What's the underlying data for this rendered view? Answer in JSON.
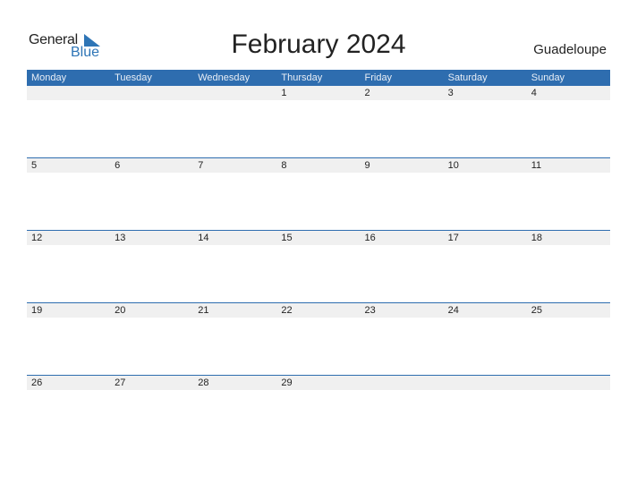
{
  "logo": {
    "text_general": "General",
    "text_blue": "Blue"
  },
  "title": "February 2024",
  "country": "Guadeloupe",
  "colors": {
    "header_bg": "#2e6daf",
    "strip_bg": "#f0f0f0",
    "accent": "#2e75b6"
  },
  "weekdays": [
    "Monday",
    "Tuesday",
    "Wednesday",
    "Thursday",
    "Friday",
    "Saturday",
    "Sunday"
  ],
  "weeks": [
    [
      "",
      "",
      "",
      "1",
      "2",
      "3",
      "4"
    ],
    [
      "5",
      "6",
      "7",
      "8",
      "9",
      "10",
      "11"
    ],
    [
      "12",
      "13",
      "14",
      "15",
      "16",
      "17",
      "18"
    ],
    [
      "19",
      "20",
      "21",
      "22",
      "23",
      "24",
      "25"
    ],
    [
      "26",
      "27",
      "28",
      "29",
      "",
      "",
      ""
    ]
  ]
}
